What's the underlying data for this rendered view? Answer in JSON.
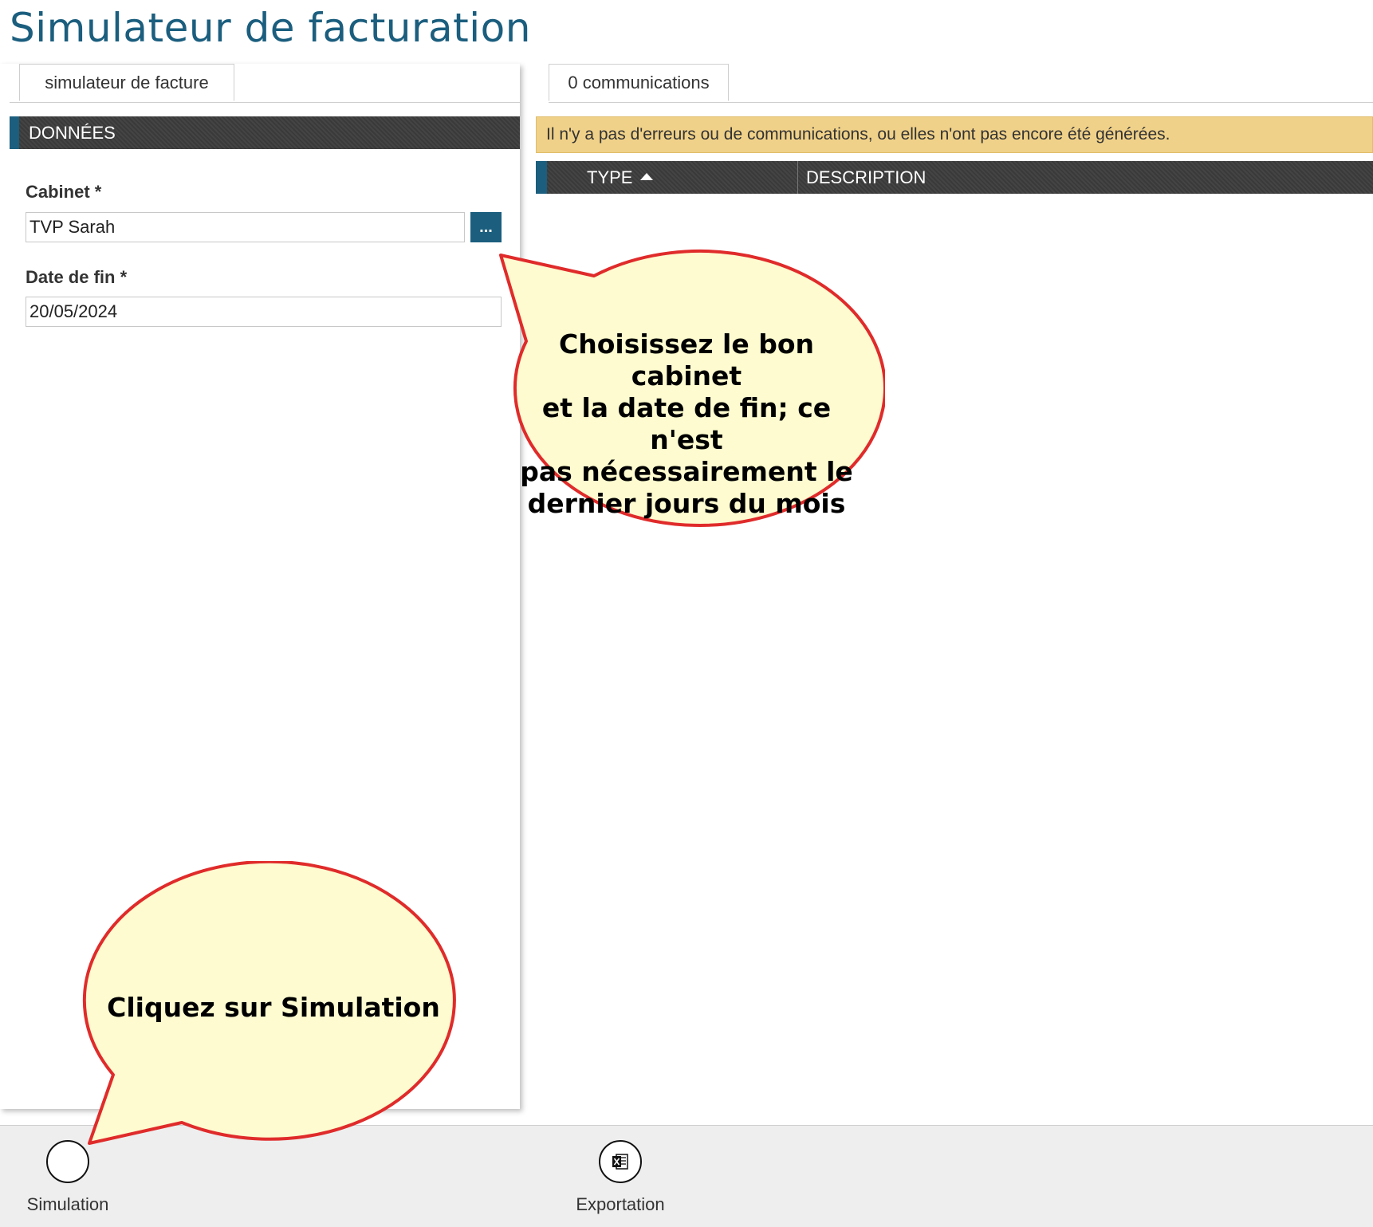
{
  "page": {
    "title": "Simulateur de facturation"
  },
  "left": {
    "tab_label": "simulateur de facture",
    "section_title": "DONNÉES",
    "cabinet": {
      "label": "Cabinet *",
      "value": "TVP Sarah",
      "browse_label": "..."
    },
    "end_date": {
      "label": "Date de fin *",
      "value": "20/05/2024"
    }
  },
  "right": {
    "tab_label": "0 communications",
    "warning": "Il n'y a pas d'erreurs ou de communications, ou elles n'ont pas encore été générées.",
    "columns": {
      "type": "TYPE",
      "description": "DESCRIPTION"
    }
  },
  "toolbar": {
    "simulation_label": "Simulation",
    "export_label": "Exportation",
    "simulation_icon": "circle-icon",
    "export_icon": "excel-icon"
  },
  "callouts": {
    "top_lines": [
      "Choisissez le bon cabinet",
      "et la date de fin; ce n'est",
      "pas nécessairement le",
      "dernier jours du mois"
    ],
    "bottom": "Cliquez sur Simulation",
    "fill": "#fdfbcf",
    "stroke": "#e02b2b"
  }
}
